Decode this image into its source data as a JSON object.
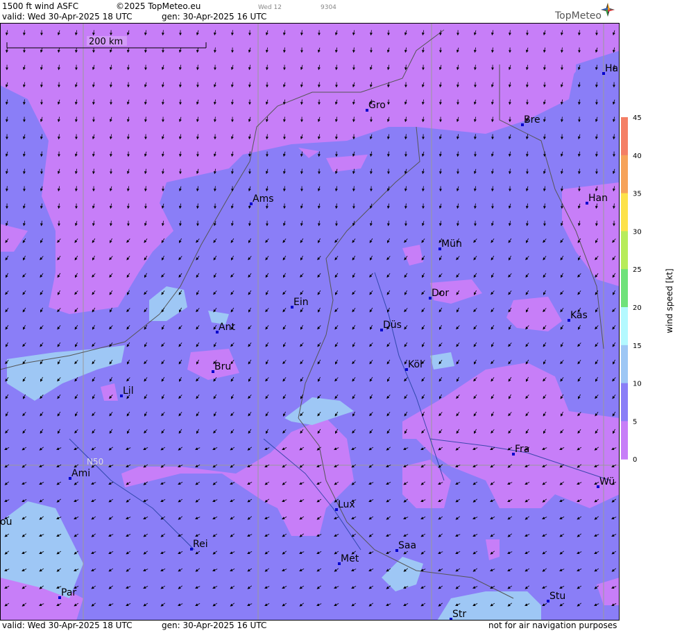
{
  "header": {
    "product": "1500 ft wind ASFC",
    "copyright": "©2025 TopMeteo.eu",
    "valid": "valid:  Wed  30-Apr-2025  18 UTC",
    "generated": "gen: 30-Apr-2025 16 UTC",
    "step_label": "Wed 12",
    "code": "9304",
    "brand": "TopMeteo"
  },
  "footer": {
    "valid": "valid:  Wed  30-Apr-2025  18 UTC",
    "generated": "gen: 30-Apr-2025 16 UTC",
    "disclaimer": "not for air navigation purposes"
  },
  "map": {
    "scale_label": "200 km",
    "latitude_label": "N50",
    "cities": [
      {
        "name": "Gro"
      },
      {
        "name": "Bre"
      },
      {
        "name": "Ha"
      },
      {
        "name": "Ams"
      },
      {
        "name": "Han"
      },
      {
        "name": "Mün"
      },
      {
        "name": "Dor"
      },
      {
        "name": "Ein"
      },
      {
        "name": "Kas"
      },
      {
        "name": "Ant"
      },
      {
        "name": "Düs"
      },
      {
        "name": "Bru"
      },
      {
        "name": "Köl"
      },
      {
        "name": "Lil"
      },
      {
        "name": "Fra"
      },
      {
        "name": "Ami"
      },
      {
        "name": "Wü"
      },
      {
        "name": "Lux"
      },
      {
        "name": "ou"
      },
      {
        "name": "Rei"
      },
      {
        "name": "Saa"
      },
      {
        "name": "Met"
      },
      {
        "name": "Par"
      },
      {
        "name": "Stu"
      },
      {
        "name": "Str"
      }
    ]
  },
  "legend": {
    "title": "wind speed [kt]",
    "ticks": [
      "45",
      "40",
      "35",
      "30",
      "25",
      "20",
      "15",
      "10",
      "5",
      "0"
    ],
    "colors": [
      "#f47f66",
      "#f6a35b",
      "#fde24a",
      "#b7ec5b",
      "#6fe27a",
      "#b3f9ff",
      "#9ec7f5",
      "#8a7ef7",
      "#c77ef8"
    ]
  },
  "colors": {
    "low_wind": "#c77ef8",
    "mid_wind": "#8a7ef7",
    "higher_wind": "#9ec7f5"
  }
}
